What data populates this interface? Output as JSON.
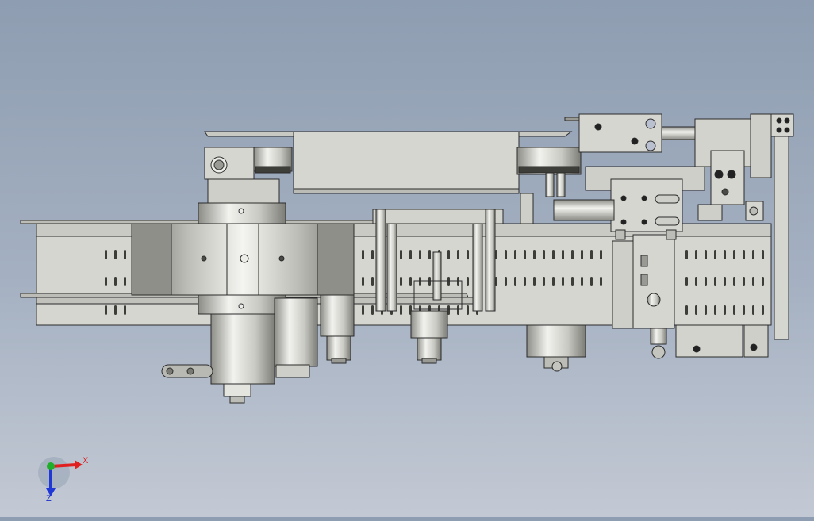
{
  "viewport": {
    "background_top": "#8e9db1",
    "background_bottom": "#c3c9d4",
    "model_color": "#d6d6d0",
    "edge_color": "#2b2b2b"
  },
  "triad": {
    "x_label": "X",
    "z_label": "Z",
    "x_color": "#e02020",
    "y_color": "#1fae2a",
    "z_color": "#1f37d6"
  }
}
